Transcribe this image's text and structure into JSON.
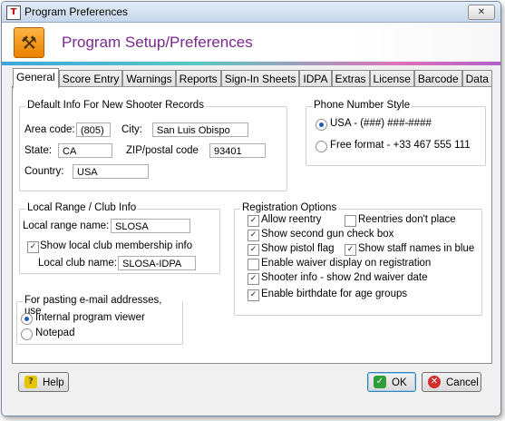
{
  "window": {
    "title": "Program Preferences",
    "close_glyph": "✕"
  },
  "header": {
    "title": "Program Setup/Preferences",
    "icon": "tools-icon"
  },
  "tabs": [
    {
      "label": "General",
      "active": true
    },
    {
      "label": "Score Entry"
    },
    {
      "label": "Warnings"
    },
    {
      "label": "Reports"
    },
    {
      "label": "Sign-In Sheets"
    },
    {
      "label": "IDPA"
    },
    {
      "label": "Extras"
    },
    {
      "label": "License"
    },
    {
      "label": "Barcode"
    },
    {
      "label": "Data"
    }
  ],
  "default_info": {
    "group_label": "Default Info For New Shooter Records",
    "area_code_label": "Area code:",
    "area_code": "(805)",
    "city_label": "City:",
    "city": "San Luis Obispo",
    "state_label": "State:",
    "state": "CA",
    "zip_label": "ZIP/postal code",
    "zip": "93401",
    "country_label": "Country:",
    "country": "USA"
  },
  "phone_style": {
    "group_label": "Phone Number Style",
    "option_usa": "USA -  (###) ###-####",
    "option_free": "Free format  -  +33 467 555 111",
    "selected": "usa"
  },
  "local_range": {
    "group_label": "Local Range / Club Info",
    "range_name_label": "Local range name:",
    "range_name": "SLOSA",
    "show_club_label": "Show local club membership info",
    "show_club_checked": true,
    "club_name_label": "Local club name:",
    "club_name": "SLOSA-IDPA"
  },
  "email": {
    "group_label": "For pasting e-mail addresses, use",
    "option_internal": "Internal program viewer",
    "option_notepad": "Notepad",
    "selected": "internal"
  },
  "registration": {
    "group_label": "Registration Options",
    "allow_reentry": "Allow reentry",
    "reentries_dont_place": "Reentries don't place",
    "second_gun": "Show second gun check box",
    "pistol_flag": "Show pistol flag",
    "staff_names_blue": "Show staff names in blue",
    "waiver_display": "Enable waiver display on registration",
    "second_waiver": "Shooter info - show 2nd waiver date",
    "birthdate_groups": "Enable birthdate for age groups",
    "checked_glyph": "✓"
  },
  "buttons": {
    "help": "Help",
    "ok": "OK",
    "cancel": "Cancel",
    "help_icon": "?",
    "ok_icon": "✓",
    "cancel_icon": "✕"
  },
  "colors": {
    "header_title": "#7b2a8c",
    "ok_icon": "#2e9d3a",
    "cancel_icon": "#d22f2f",
    "help_icon": "#e5c500"
  }
}
